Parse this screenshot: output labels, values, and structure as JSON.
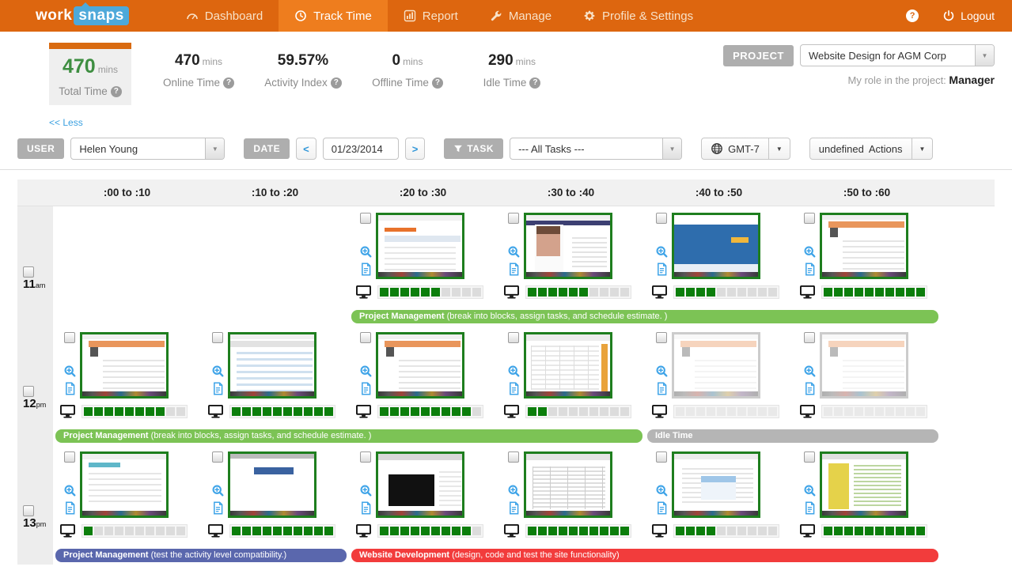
{
  "nav": {
    "logo_work": "work",
    "logo_snaps": "snaps",
    "items": [
      {
        "label": "Dashboard",
        "icon": "dashboard-icon",
        "active": false
      },
      {
        "label": "Track Time",
        "icon": "clock-icon",
        "active": true
      },
      {
        "label": "Report",
        "icon": "report-icon",
        "active": false
      },
      {
        "label": "Manage",
        "icon": "wrench-icon",
        "active": false
      },
      {
        "label": "Profile & Settings",
        "icon": "gear-icon",
        "active": false
      }
    ],
    "help_icon": "?",
    "logout_label": "Logout"
  },
  "stats": {
    "total": {
      "value": "470",
      "unit": "mins",
      "label": "Total Time"
    },
    "items": [
      {
        "value": "470",
        "unit": "mins",
        "label": "Online Time"
      },
      {
        "value": "59.57%",
        "unit": "",
        "label": "Activity Index"
      },
      {
        "value": "0",
        "unit": "mins",
        "label": "Offline Time"
      },
      {
        "value": "290",
        "unit": "mins",
        "label": "Idle Time"
      }
    ],
    "less_link": "<< Less"
  },
  "project": {
    "badge": "PROJECT",
    "value": "Website Design for AGM Corp",
    "role_label": "My role in the project:",
    "role_value": "Manager"
  },
  "filters": {
    "user_badge": "USER",
    "user_value": "Helen Young",
    "date_badge": "DATE",
    "date_value": "01/23/2014",
    "prev_icon": "<",
    "next_icon": ">",
    "task_badge": "TASK",
    "task_value": "--- All Tasks ---",
    "timezone_label": "GMT-7",
    "actions_label": "Actions"
  },
  "icons": {
    "caret_down": "▼",
    "help": "?"
  },
  "colors": {
    "navbar": "#dd660f",
    "nav_active": "#ee7d1e",
    "logo_blue": "#4ea9da",
    "total_green": "#3e8e41",
    "link_blue": "#3aa0e0",
    "activity_green": "#0c7e0c",
    "thumb_border_green": "#1e7e1e",
    "bar_green": "#7cc355",
    "bar_gray": "#b5b5b5",
    "bar_blue": "#5a67ad",
    "bar_red": "#f23c3c"
  },
  "grid": {
    "columns": [
      ":00 to :10",
      ":10 to :20",
      ":20 to :30",
      ":30 to :40",
      ":40 to :50",
      ":50 to :60"
    ],
    "segments_per_bar": 10,
    "rows": [
      {
        "hour": "11",
        "suffix": "am",
        "cells": [
          {
            "empty": true
          },
          {
            "empty": true
          },
          {
            "thumb": "page-list",
            "segments": 6,
            "idle": false
          },
          {
            "thumb": "page-face",
            "segments": 6,
            "idle": false
          },
          {
            "thumb": "site-blue",
            "segments": 4,
            "idle": false
          },
          {
            "thumb": "app-orange",
            "segments": 10,
            "idle": false
          }
        ],
        "bars": [
          {
            "label": "Project Management",
            "desc": "(break into blocks, assign tasks, and schedule estimate. )",
            "color": "#7cc355",
            "start": 2,
            "span": 4
          }
        ]
      },
      {
        "hour": "12",
        "suffix": "pm",
        "cells": [
          {
            "thumb": "app-orange",
            "segments": 8,
            "idle": false
          },
          {
            "thumb": "app-list",
            "segments": 10,
            "idle": false
          },
          {
            "thumb": "app-orange",
            "segments": 9,
            "idle": false
          },
          {
            "thumb": "app-columns",
            "segments": 2,
            "idle": false
          },
          {
            "thumb": "app-orange",
            "segments": 0,
            "idle": true
          },
          {
            "thumb": "app-orange",
            "segments": 0,
            "idle": true
          }
        ],
        "bars": [
          {
            "label": "Project Management",
            "desc": "(break into blocks, assign tasks, and schedule estimate. )",
            "color": "#7cc355",
            "start": 0,
            "span": 4
          },
          {
            "label": "Idle Time",
            "desc": "",
            "color": "#b5b5b5",
            "start": 4,
            "span": 2
          }
        ]
      },
      {
        "hour": "13",
        "suffix": "pm",
        "cells": [
          {
            "thumb": "app-light",
            "segments": 1,
            "idle": false
          },
          {
            "thumb": "desktop-dialog",
            "segments": 10,
            "idle": false
          },
          {
            "thumb": "terminal",
            "segments": 9,
            "idle": false
          },
          {
            "thumb": "code-columns",
            "segments": 10,
            "idle": false
          },
          {
            "thumb": "app-dialog",
            "segments": 4,
            "idle": false
          },
          {
            "thumb": "code-colored",
            "segments": 10,
            "idle": false
          }
        ],
        "bars": [
          {
            "label": "Project Management",
            "desc": "(test the activity level compatibility.)",
            "color": "#5a67ad",
            "start": 0,
            "span": 2
          },
          {
            "label": "Website Development",
            "desc": "(design, code and test the site functionality)",
            "color": "#f23c3c",
            "start": 2,
            "span": 4
          }
        ]
      }
    ]
  }
}
